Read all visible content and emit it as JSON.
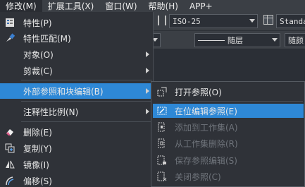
{
  "menubar": {
    "items": [
      "修改(M)",
      "扩展工具(X)",
      "窗口(W)",
      "帮助(H)",
      "APP+"
    ]
  },
  "toolbar": {
    "dimstyle": "ISO-25",
    "tablestyle": "Standard",
    "linetype": "随层",
    "lineweight": "随颜"
  },
  "menu": {
    "items": [
      {
        "label": "特性(P)",
        "icon": "properties-icon"
      },
      {
        "label": "特性匹配(M)",
        "icon": "match-properties-icon"
      },
      {
        "label": "对象(O)"
      },
      {
        "label": "剪裁(C)"
      },
      {
        "label": "外部参照和块编辑(B)"
      },
      {
        "label": "注释性比例(N)"
      },
      {
        "label": "删除(E)",
        "icon": "erase-icon"
      },
      {
        "label": "复制(Y)",
        "icon": "copy-icon"
      },
      {
        "label": "镜像(I)",
        "icon": "mirror-icon"
      },
      {
        "label": "偏移(S)",
        "icon": "offset-icon"
      }
    ]
  },
  "submenu": {
    "items": [
      {
        "label": "打开参照(O)",
        "enabled": true
      },
      {
        "label": "在位编辑参照(E)",
        "enabled": true
      },
      {
        "label": "添加到工作集(A)",
        "enabled": false
      },
      {
        "label": "从工作集删除(R)",
        "enabled": false
      },
      {
        "label": "保存参照编辑(S)",
        "enabled": false
      },
      {
        "label": "关闭参照(C)",
        "enabled": false
      }
    ]
  },
  "colors": {
    "highlight": "#2e88d6",
    "menu_bg": "#2f3238",
    "menubar_bg": "#3b3f45",
    "disabled_text": "#6f747b"
  }
}
